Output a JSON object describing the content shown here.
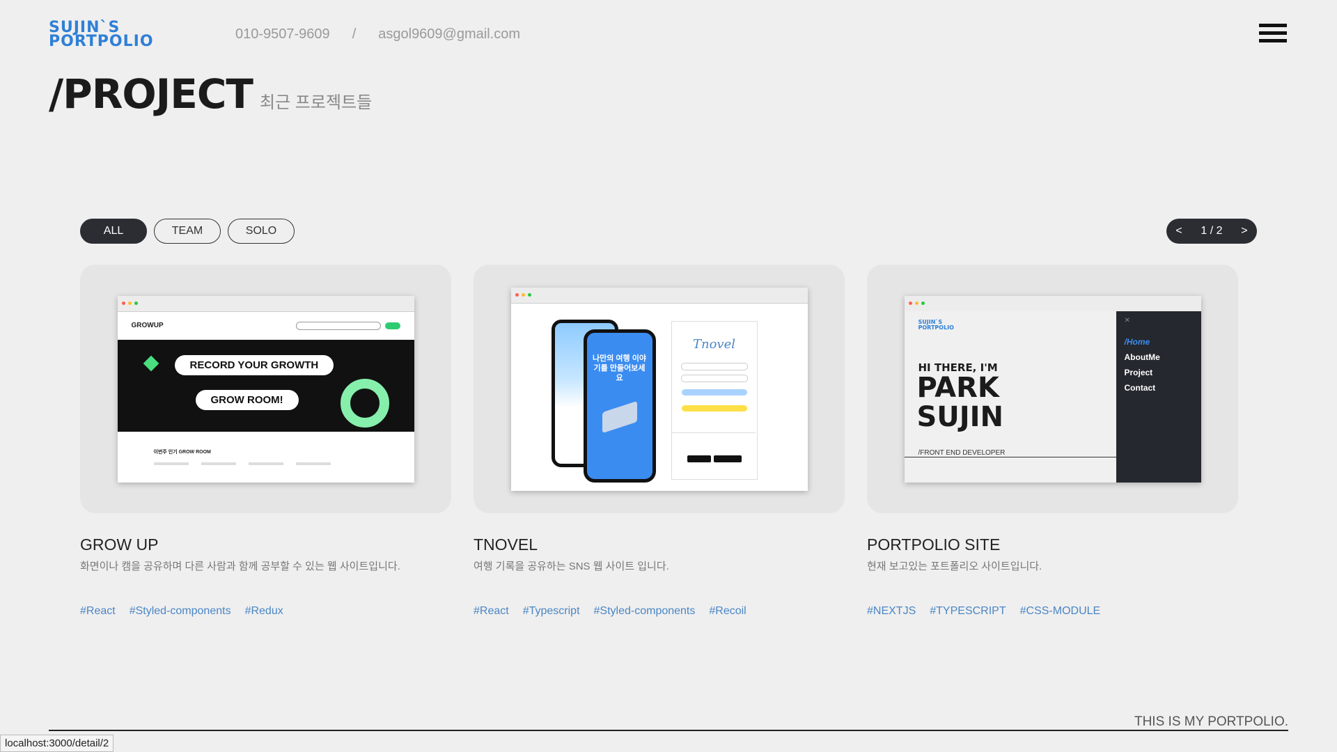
{
  "header": {
    "logo_line1": "SUJIN`S",
    "logo_line2": "PORTPOLIO",
    "phone": "010-9507-9609",
    "separator": "/",
    "email": "asgol9609@gmail.com"
  },
  "page": {
    "title": "/PROJECT",
    "subtitle": "최근 프로젝트들"
  },
  "filters": [
    {
      "label": "ALL",
      "active": true
    },
    {
      "label": "TEAM",
      "active": false
    },
    {
      "label": "SOLO",
      "active": false
    }
  ],
  "pager": {
    "prev": "<",
    "current": "1 / 2",
    "next": ">"
  },
  "projects": [
    {
      "title": "GROW UP",
      "description": "화면이나 캠을 공유하며 다른 사람과 함께 공부할 수 있는 웹 사이트입니다.",
      "tags": [
        "#React",
        "#Styled-components",
        "#Redux"
      ],
      "preview": {
        "brand": "GROWUP",
        "hero1": "RECORD YOUR GROWTH",
        "hero2": "GROW ROOM!",
        "section": "이번주 인기 GROW ROOM"
      }
    },
    {
      "title": "TNOVEL",
      "description": "여행 기록을 공유하는 SNS 웹 사이트 입니다.",
      "tags": [
        "#React",
        "#Typescript",
        "#Styled-components",
        "#Recoil"
      ],
      "preview": {
        "brand": "Tnovel",
        "phone_text": "나만의 여행 이야기를 만들어보세요"
      }
    },
    {
      "title": "PORTPOLIO SITE",
      "description": "현재 보고있는 포트폴리오 사이트입니다.",
      "tags": [
        "#NEXTJS",
        "#TYPESCRIPT",
        "#CSS-MODULE"
      ],
      "preview": {
        "line1": "HI THERE, I'M",
        "line2": "PARK",
        "line3": "SUJIN",
        "role": "/FRONT END DEVELOPER",
        "menu": [
          "/Home",
          "AboutMe",
          "Project",
          "Contact"
        ]
      }
    }
  ],
  "footer": {
    "text": "THIS IS MY PORTPOLIO."
  },
  "status_bar": {
    "url": "localhost:3000/detail/2"
  },
  "colors": {
    "accent": "#2f7fd6",
    "dark": "#2b2d33",
    "tag": "#4a86c5",
    "background": "#efefef"
  }
}
